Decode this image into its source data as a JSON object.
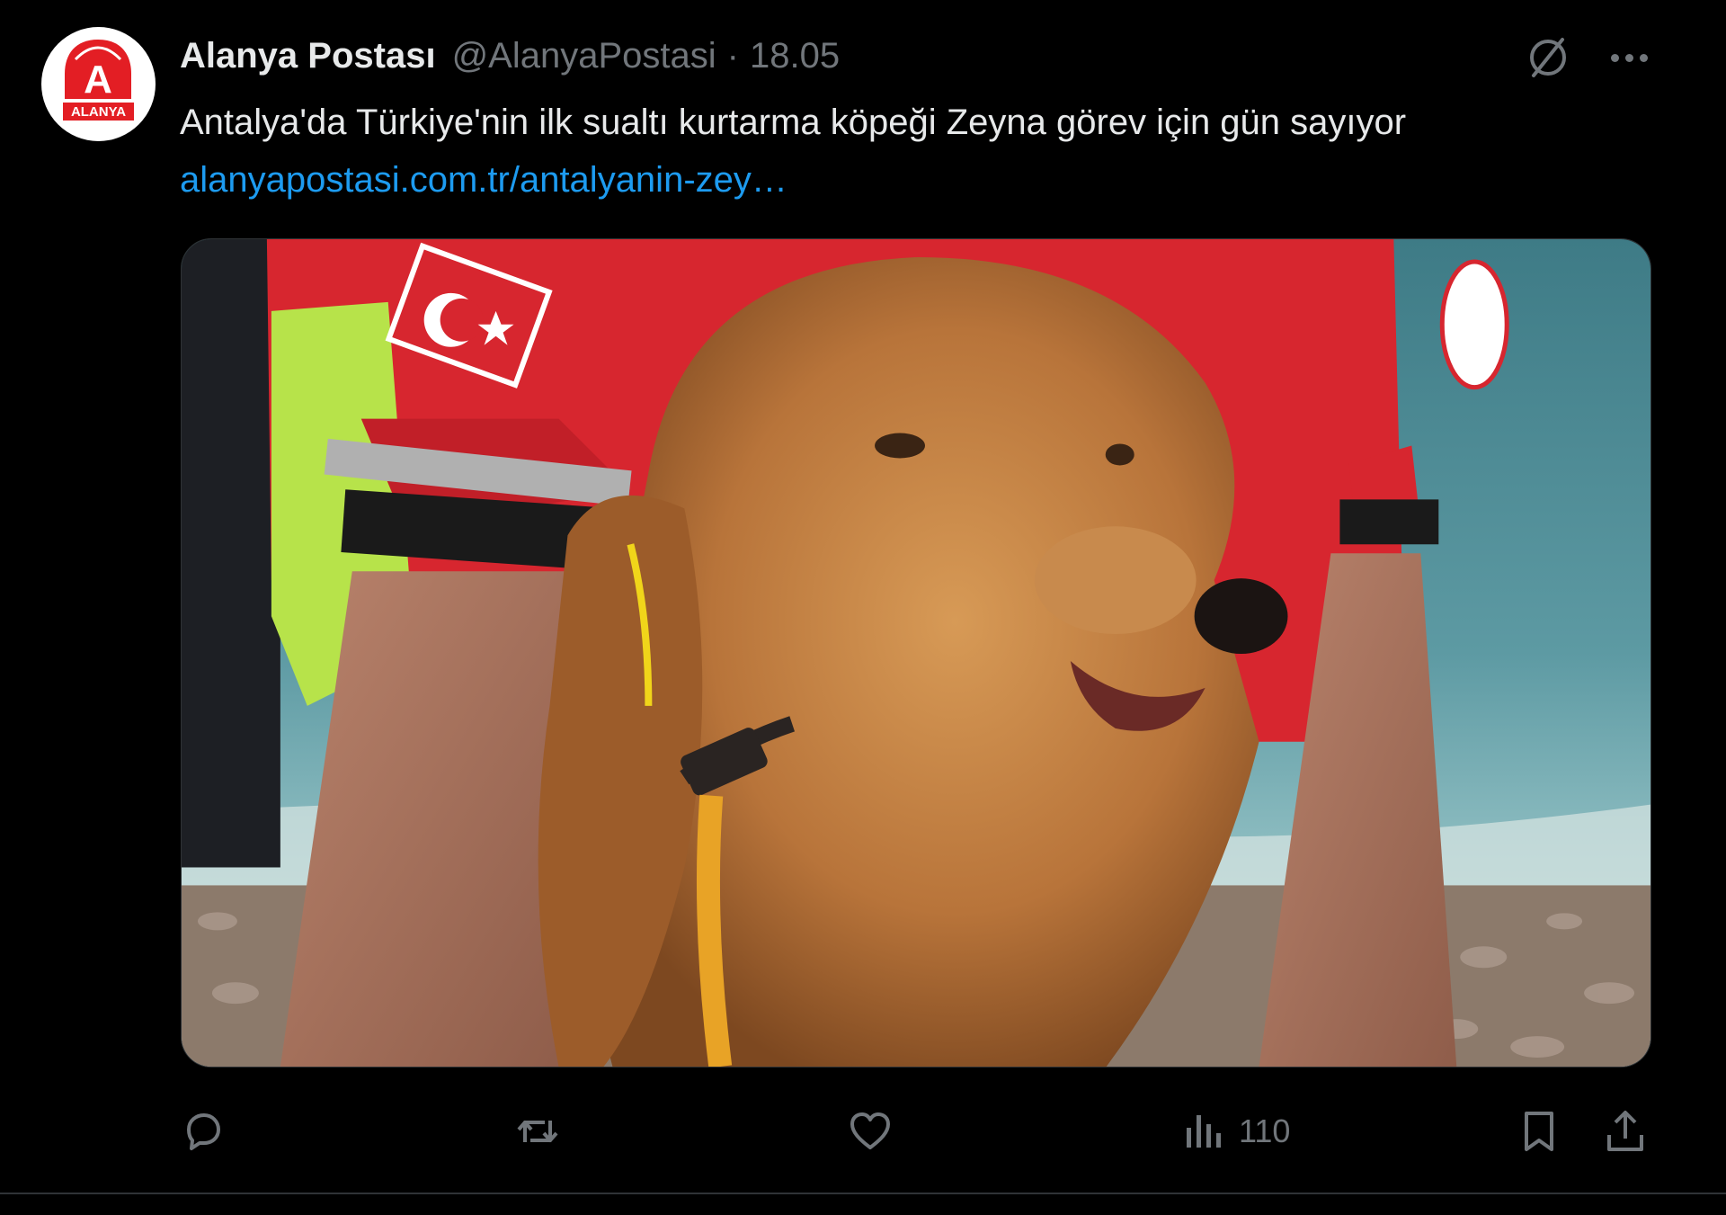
{
  "tweet": {
    "display_name": "Alanya Postası",
    "handle": "@AlanyaPostasi",
    "separator": "·",
    "time": "18.05",
    "text": "Antalya'da Türkiye'nin ilk sualtı kurtarma köpeği Zeyna görev için gün sayıyor ",
    "link": "alanyapostasi.com.tr/antalyanin-zey…",
    "avatar": {
      "logo_letter": "A",
      "logo_text": "ALANYA",
      "brand_color": "#e31e24"
    }
  },
  "media": {
    "icon": "photo-golden-retriever-rescue-dog-beach"
  },
  "actions": {
    "reply": {
      "icon": "reply-icon"
    },
    "retweet": {
      "icon": "retweet-icon"
    },
    "like": {
      "icon": "heart-icon"
    },
    "views": {
      "icon": "analytics-icon",
      "count": "110"
    },
    "bookmark": {
      "icon": "bookmark-icon"
    },
    "share": {
      "icon": "share-icon"
    }
  },
  "colors": {
    "background": "#000000",
    "text": "#e7e9ea",
    "secondary": "#71767b",
    "link": "#1d9bf0"
  }
}
